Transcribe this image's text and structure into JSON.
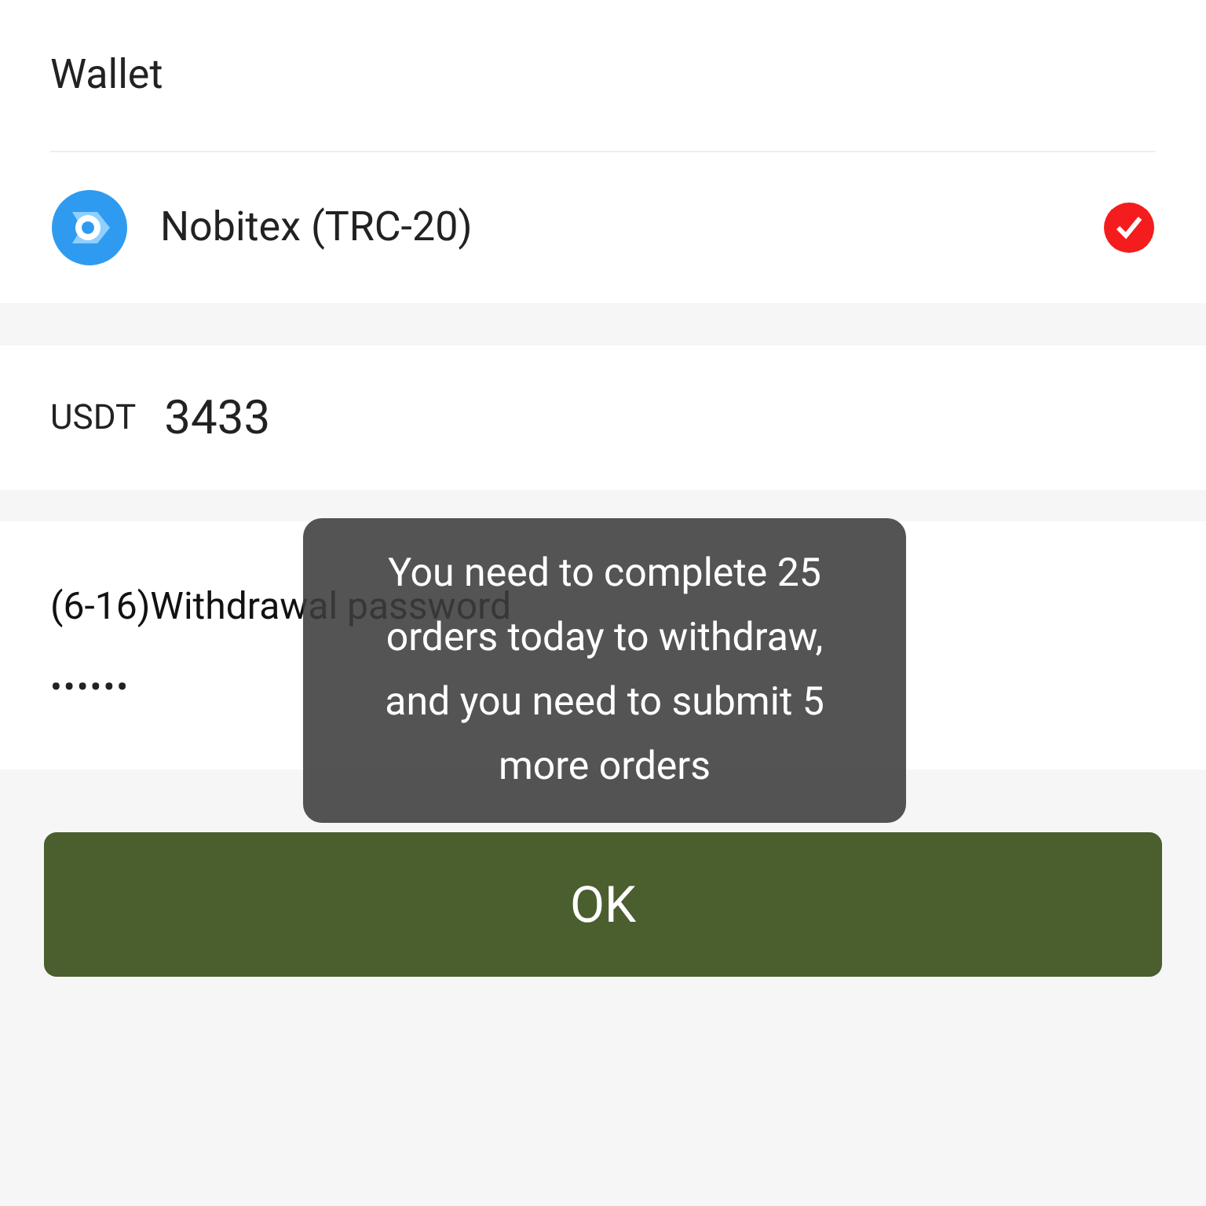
{
  "wallet_section": {
    "title": "Wallet",
    "items": [
      {
        "name": "Nobitex (TRC-20)",
        "selected": true
      }
    ]
  },
  "amount": {
    "currency": "USDT",
    "value": "3433"
  },
  "password": {
    "label": "(6-16)Withdrawal password",
    "value": "••••••"
  },
  "toast": {
    "message": "You need to complete 25 orders today to withdraw, and you need to submit 5 more orders"
  },
  "ok_button": {
    "label": "OK"
  }
}
